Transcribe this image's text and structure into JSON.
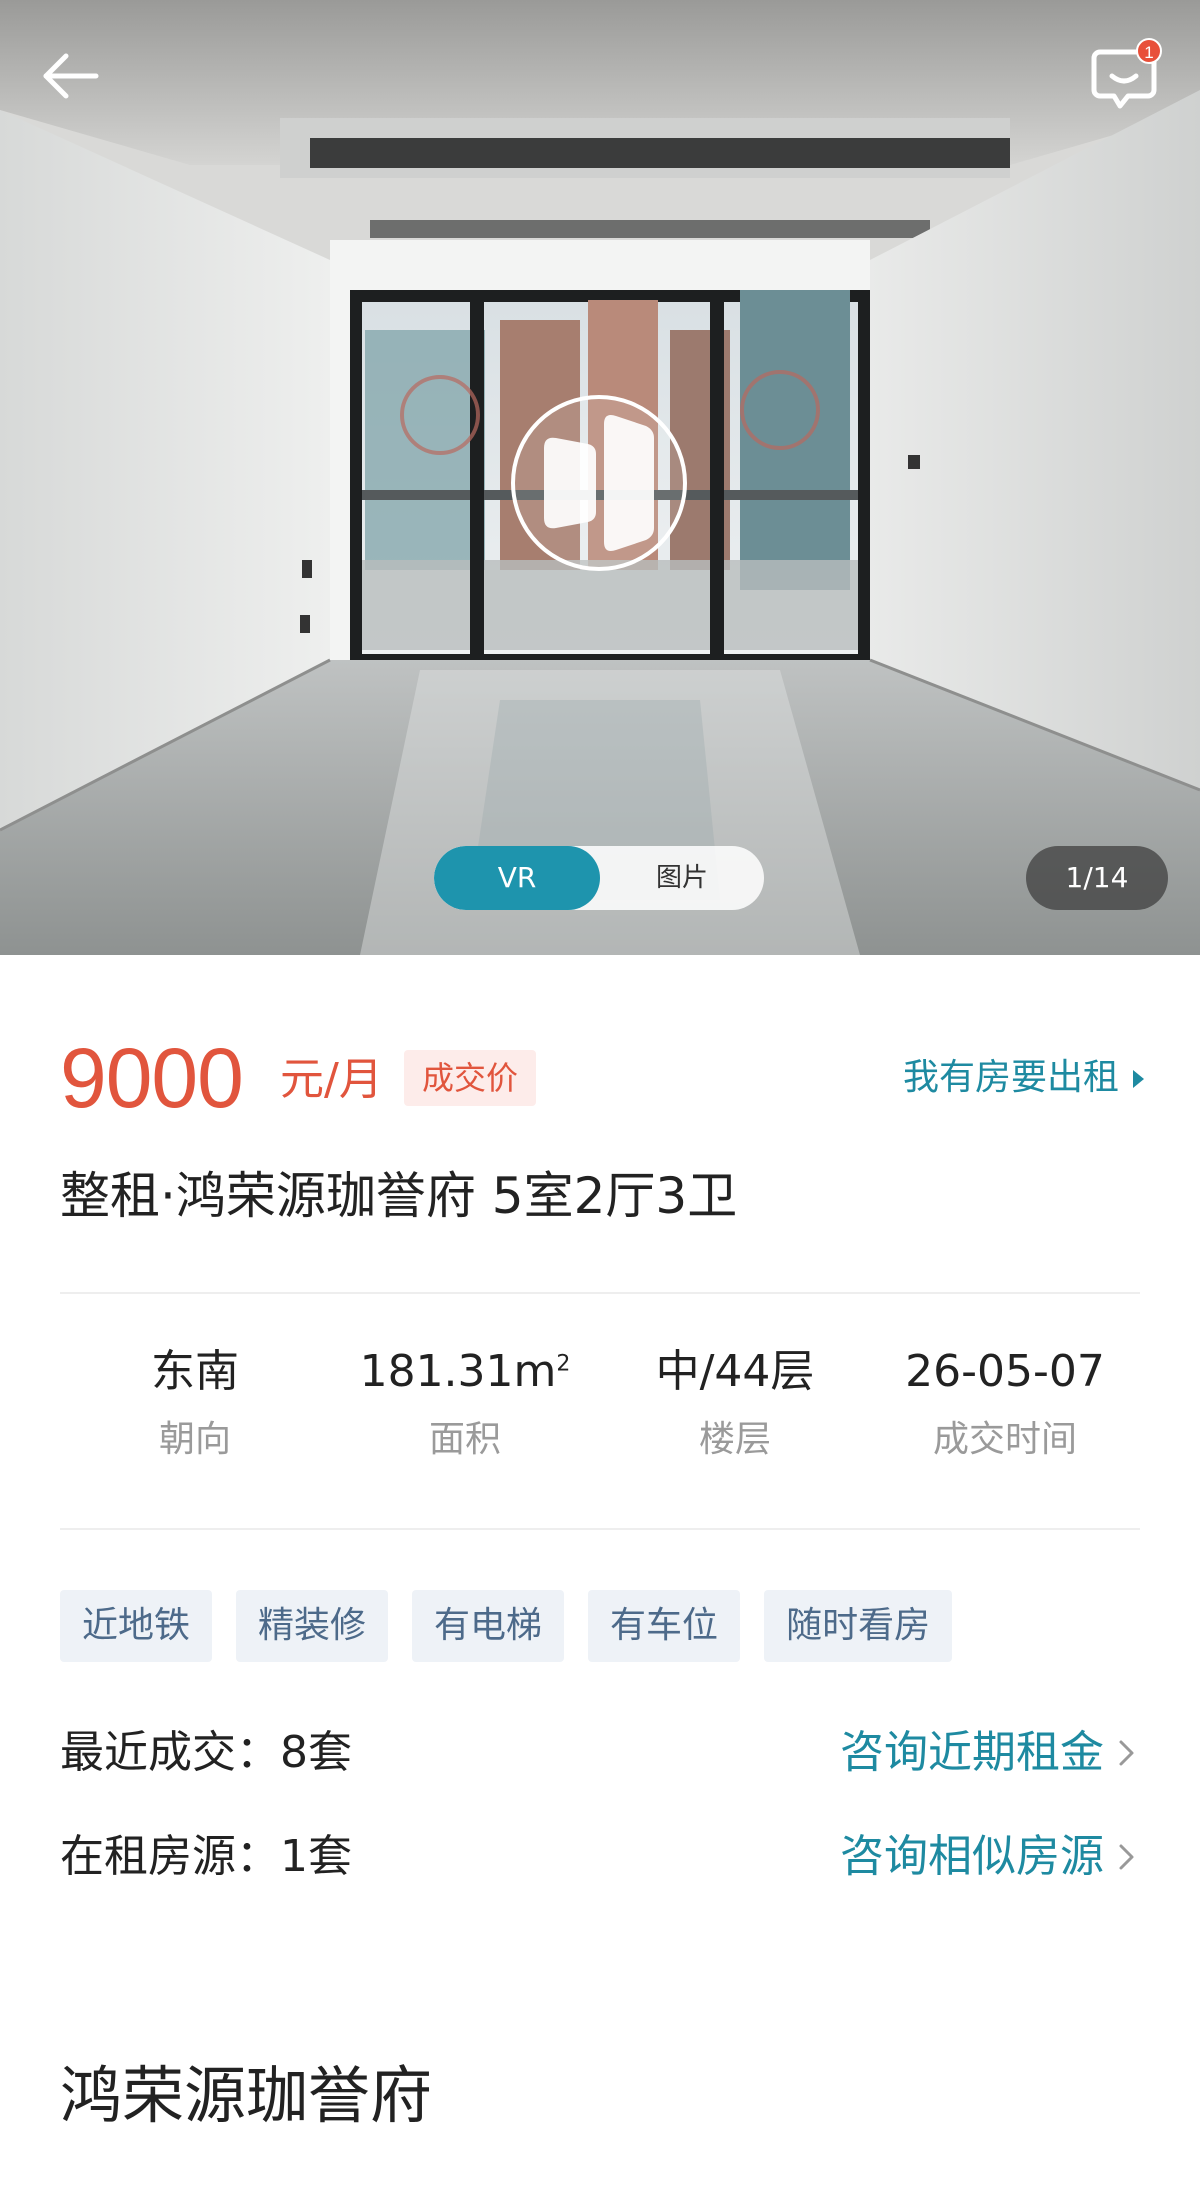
{
  "header": {
    "back_icon": "arrow-left-icon",
    "message_icon": "chat-bubble-icon",
    "message_badge": "1"
  },
  "gallery": {
    "vr_label": "VR",
    "photo_label": "图片",
    "counter": "1/14",
    "vr_icon": "vr-play-icon"
  },
  "listing": {
    "price": "9000",
    "unit": "元/月",
    "price_tag": "成交价",
    "rent_out_link": "我有房要出租",
    "title": "整租·鸿荣源珈誉府 5室2厅3卫",
    "stats": [
      {
        "value": "东南",
        "label": "朝向"
      },
      {
        "value": "181.31m",
        "value_sup": "2",
        "label": "面积"
      },
      {
        "value": "中/44层",
        "label": "楼层"
      },
      {
        "value": "26-05-07",
        "label": "成交时间"
      }
    ],
    "tags": [
      "近地铁",
      "精装修",
      "有电梯",
      "有车位",
      "随时看房"
    ],
    "recent_deals_label": "最近成交：8套",
    "recent_deals_action": "咨询近期租金",
    "for_rent_label": "在租房源：1套",
    "for_rent_action": "咨询相似房源"
  },
  "community": {
    "name": "鸿荣源珈誉府"
  },
  "colors": {
    "accent": "#1e94ad",
    "price": "#e1553d",
    "link": "#1e8aa1"
  }
}
